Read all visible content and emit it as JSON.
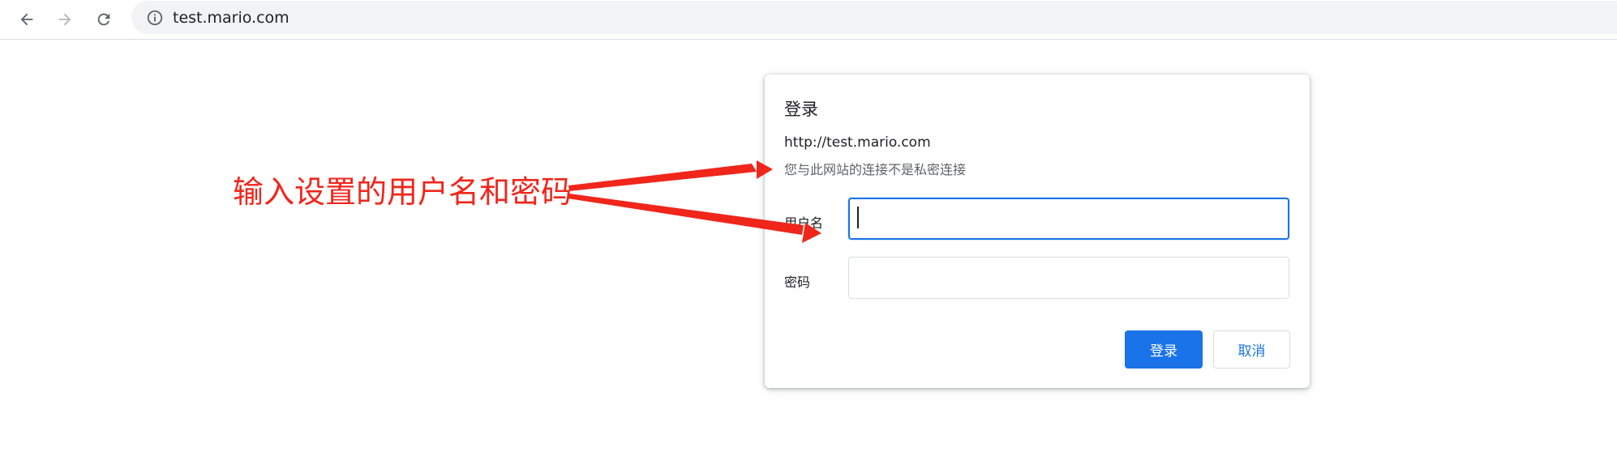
{
  "browser": {
    "address_bar": {
      "url": "test.mario.com"
    },
    "icons": {
      "back": "arrow-left-icon",
      "forward": "arrow-right-icon",
      "reload": "reload-icon",
      "site_info": "info-icon"
    }
  },
  "auth_dialog": {
    "title": "登录",
    "site_url": "http://test.mario.com",
    "warning": "您与此网站的连接不是私密连接",
    "username_label": "用户名",
    "password_label": "密码",
    "username_value": "",
    "password_value": "",
    "signin_button": "登录",
    "cancel_button": "取消"
  },
  "annotation": {
    "text": "输入设置的用户名和密码",
    "color": "#f0261b"
  },
  "colors": {
    "accent": "#1a73e8",
    "annotation_red": "#f0261b"
  }
}
